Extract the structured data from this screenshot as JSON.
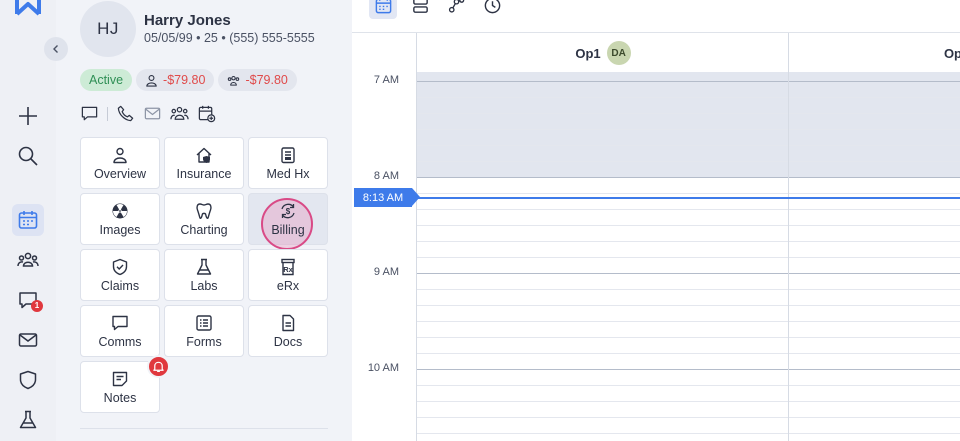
{
  "patient": {
    "initials": "HJ",
    "name": "Harry Jones",
    "meta": "05/05/99 • 25 • (555) 555-5555",
    "status": "Active",
    "balance_patient": "-$79.80",
    "balance_family": "-$79.80"
  },
  "rail": {
    "messages_badge": "1"
  },
  "tiles": [
    {
      "label": "Overview",
      "icon": "person-icon"
    },
    {
      "label": "Insurance",
      "icon": "house-shield-icon"
    },
    {
      "label": "Med Hx",
      "icon": "clipboard-icon"
    },
    {
      "label": "Images",
      "icon": "radiation-icon"
    },
    {
      "label": "Charting",
      "icon": "tooth-icon"
    },
    {
      "label": "Billing",
      "icon": "dollar-cycle-icon"
    },
    {
      "label": "Claims",
      "icon": "shield-check-icon"
    },
    {
      "label": "Labs",
      "icon": "flask-icon"
    },
    {
      "label": "eRx",
      "icon": "rx-icon"
    },
    {
      "label": "Comms",
      "icon": "chat-icon"
    },
    {
      "label": "Forms",
      "icon": "form-icon"
    },
    {
      "label": "Docs",
      "icon": "document-icon"
    },
    {
      "label": "Notes",
      "icon": "note-icon"
    }
  ],
  "schedule": {
    "columns": [
      {
        "label": "Op1",
        "provider": "DA"
      },
      {
        "label": "Op",
        "provider": ""
      }
    ],
    "time_labels": [
      "7 AM",
      "8 AM",
      "9 AM",
      "10 AM"
    ],
    "now_label": "8:13 AM"
  },
  "colors": {
    "accent": "#3e7bea",
    "active_green": "#2f8f55",
    "negative_red": "#e04a4a",
    "badge_red": "#e0383e",
    "highlight_pink": "#d94a86"
  }
}
